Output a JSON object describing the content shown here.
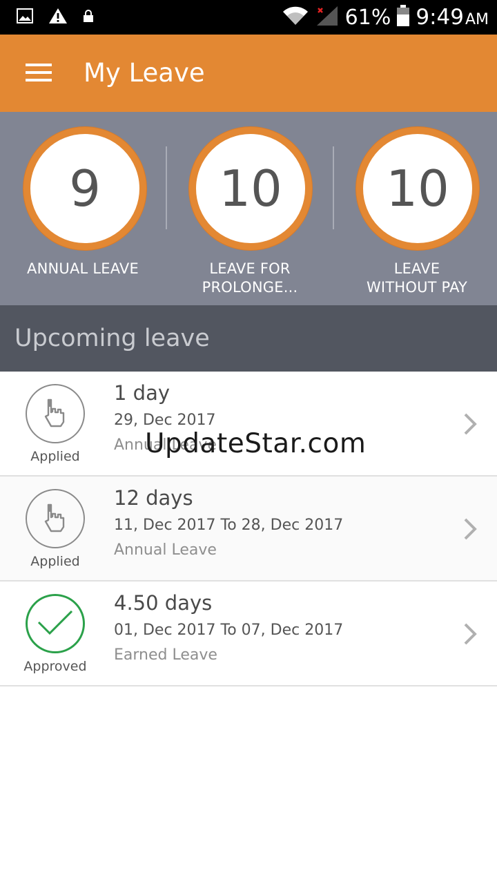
{
  "status_bar": {
    "battery_pct": "61%",
    "time": "9:49",
    "ampm": "AM",
    "icons": [
      "gallery-icon",
      "warning-icon",
      "lock-icon",
      "wifi-icon",
      "signal-icon",
      "battery-icon"
    ]
  },
  "app_bar": {
    "title": "My Leave",
    "menu_icon": "hamburger-icon",
    "color": "#e38833"
  },
  "balances": [
    {
      "value": "9",
      "label_line1": "ANNUAL LEAVE",
      "label_line2": ""
    },
    {
      "value": "10",
      "label_line1": "LEAVE FOR",
      "label_line2": "PROLONGE..."
    },
    {
      "value": "10",
      "label_line1": "LEAVE",
      "label_line2": "WITHOUT PAY"
    }
  ],
  "upcoming": {
    "title": "Upcoming leave",
    "items": [
      {
        "status": "Applied",
        "status_icon": "hand-pointer-icon",
        "duration": "1 day",
        "dates": "29, Dec 2017",
        "type": "Annual Leave"
      },
      {
        "status": "Applied",
        "status_icon": "hand-pointer-icon",
        "duration": "12 days",
        "dates": "11, Dec 2017 To 28, Dec 2017",
        "type": "Annual Leave"
      },
      {
        "status": "Approved",
        "status_icon": "check-icon",
        "duration": "4.50 days",
        "dates": "01, Dec 2017 To 07, Dec 2017",
        "type": "Earned Leave"
      }
    ]
  },
  "watermark": "UpdateStar.com",
  "colors": {
    "accent": "#e38833",
    "balance_bg": "#818593",
    "section_bg": "#525660",
    "approved": "#2ba14a"
  }
}
